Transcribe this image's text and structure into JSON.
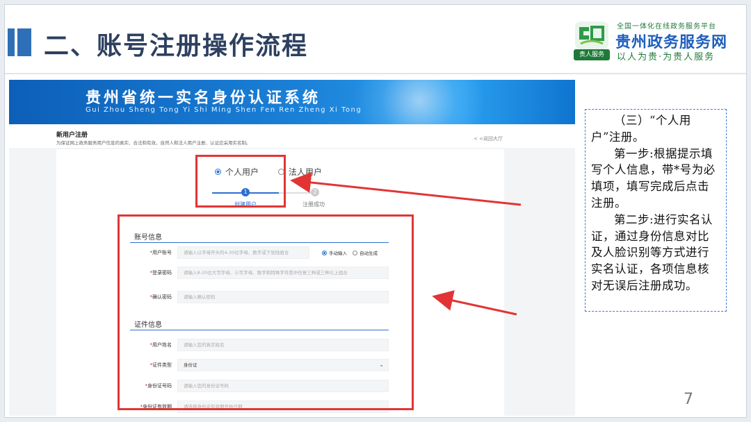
{
  "slide": {
    "title": "二、账号注册操作流程",
    "page_number": "7",
    "accent_color": "#2f6fb8"
  },
  "logo": {
    "tagline": "全国一体化在线政务服务平台",
    "name": "贵州政务服务网",
    "slogan": "以人为贵·为贵人服务",
    "badge": "贵人服务"
  },
  "screenshot": {
    "banner_title": "贵州省统一实名身份认证系统",
    "banner_subtitle": "Gui Zhou Sheng Tong Yi Shi Ming Shen Fen Ren Zheng Xi Tong",
    "page_title": "新用户注册",
    "page_desc": "为保证网上政务服务用户信息的真实、合法和有效，自然人和法人用户注册、认证应采用实名制。",
    "back_link": "< <返回大厅",
    "user_types": [
      {
        "label": "个人用户",
        "selected": true
      },
      {
        "label": "法人用户",
        "selected": false
      }
    ],
    "steps": [
      {
        "num": "1",
        "label": "创建用户",
        "active": true
      },
      {
        "num": "2",
        "label": "注册成功",
        "active": false
      }
    ],
    "account_section": {
      "heading": "账号信息",
      "fields": [
        {
          "label": "用户账号",
          "placeholder": "请输入以字母开头的4-30位字母、数字或下划线组合"
        },
        {
          "label": "登录密码",
          "placeholder": "请输入8-20位大写字母、小写字母、数字和特殊字符其中任意三种或三种以上组合"
        },
        {
          "label": "确认密码",
          "placeholder": "请输入确认密码"
        }
      ],
      "input_modes": [
        {
          "label": "手动输入",
          "selected": true
        },
        {
          "label": "自动生成",
          "selected": false
        }
      ]
    },
    "id_section": {
      "heading": "证件信息",
      "fields": [
        {
          "label": "用户姓名",
          "placeholder": "请输入您的真实姓名"
        },
        {
          "label": "证件类型",
          "value": "身份证"
        },
        {
          "label": "身份证号码",
          "placeholder": "请输入您的身份证号码"
        },
        {
          "label": "身份证有效期",
          "placeholder": "请选择身份证有效期开始日期"
        }
      ]
    }
  },
  "callout": {
    "p1": "（三）“个人用户”注册。",
    "p2": "第一步:根据提示填写个人信息，带*号为必填项，填写完成后点击注册。",
    "p3": "第二步:进行实名认证，通过身份信息对比及人脸识别等方式进行实名认证，各项信息核对无误后注册成功。"
  },
  "colors": {
    "highlight": "#e23434",
    "banner_blue": "#1a7fd6",
    "logo_blue": "#1f5fbf",
    "logo_green": "#1f7a3a"
  }
}
